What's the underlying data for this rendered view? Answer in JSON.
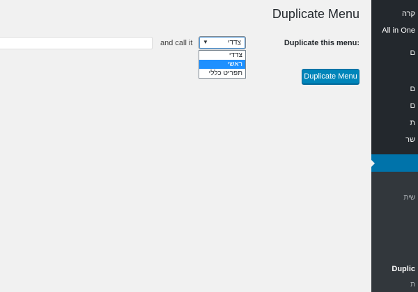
{
  "page": {
    "title": "Duplicate Menu"
  },
  "form": {
    "duplicate_label": "Duplicate this menu:",
    "selected_menu": "צדדי",
    "options": [
      "צדדי",
      "ראשי",
      "תפריט כללי"
    ],
    "highlighted_option_index": 1,
    "and_call_it": "and call it",
    "new_name_value": "",
    "submit_label": "Duplicate Menu"
  },
  "sidebar": {
    "items": [
      {
        "label": "קרה"
      },
      {
        "label": "All in One"
      },
      {
        "label": "ם"
      },
      {
        "label": "ם"
      },
      {
        "label": "ם"
      },
      {
        "label": "ת"
      },
      {
        "label": "שר"
      },
      {
        "label": "שית"
      },
      {
        "label": "Duplic"
      },
      {
        "label": "ת"
      }
    ]
  },
  "colors": {
    "accent": "#0073aa",
    "button": "#0085ba",
    "sidebar_bg": "#23282d",
    "highlight": "#1e90ff"
  }
}
